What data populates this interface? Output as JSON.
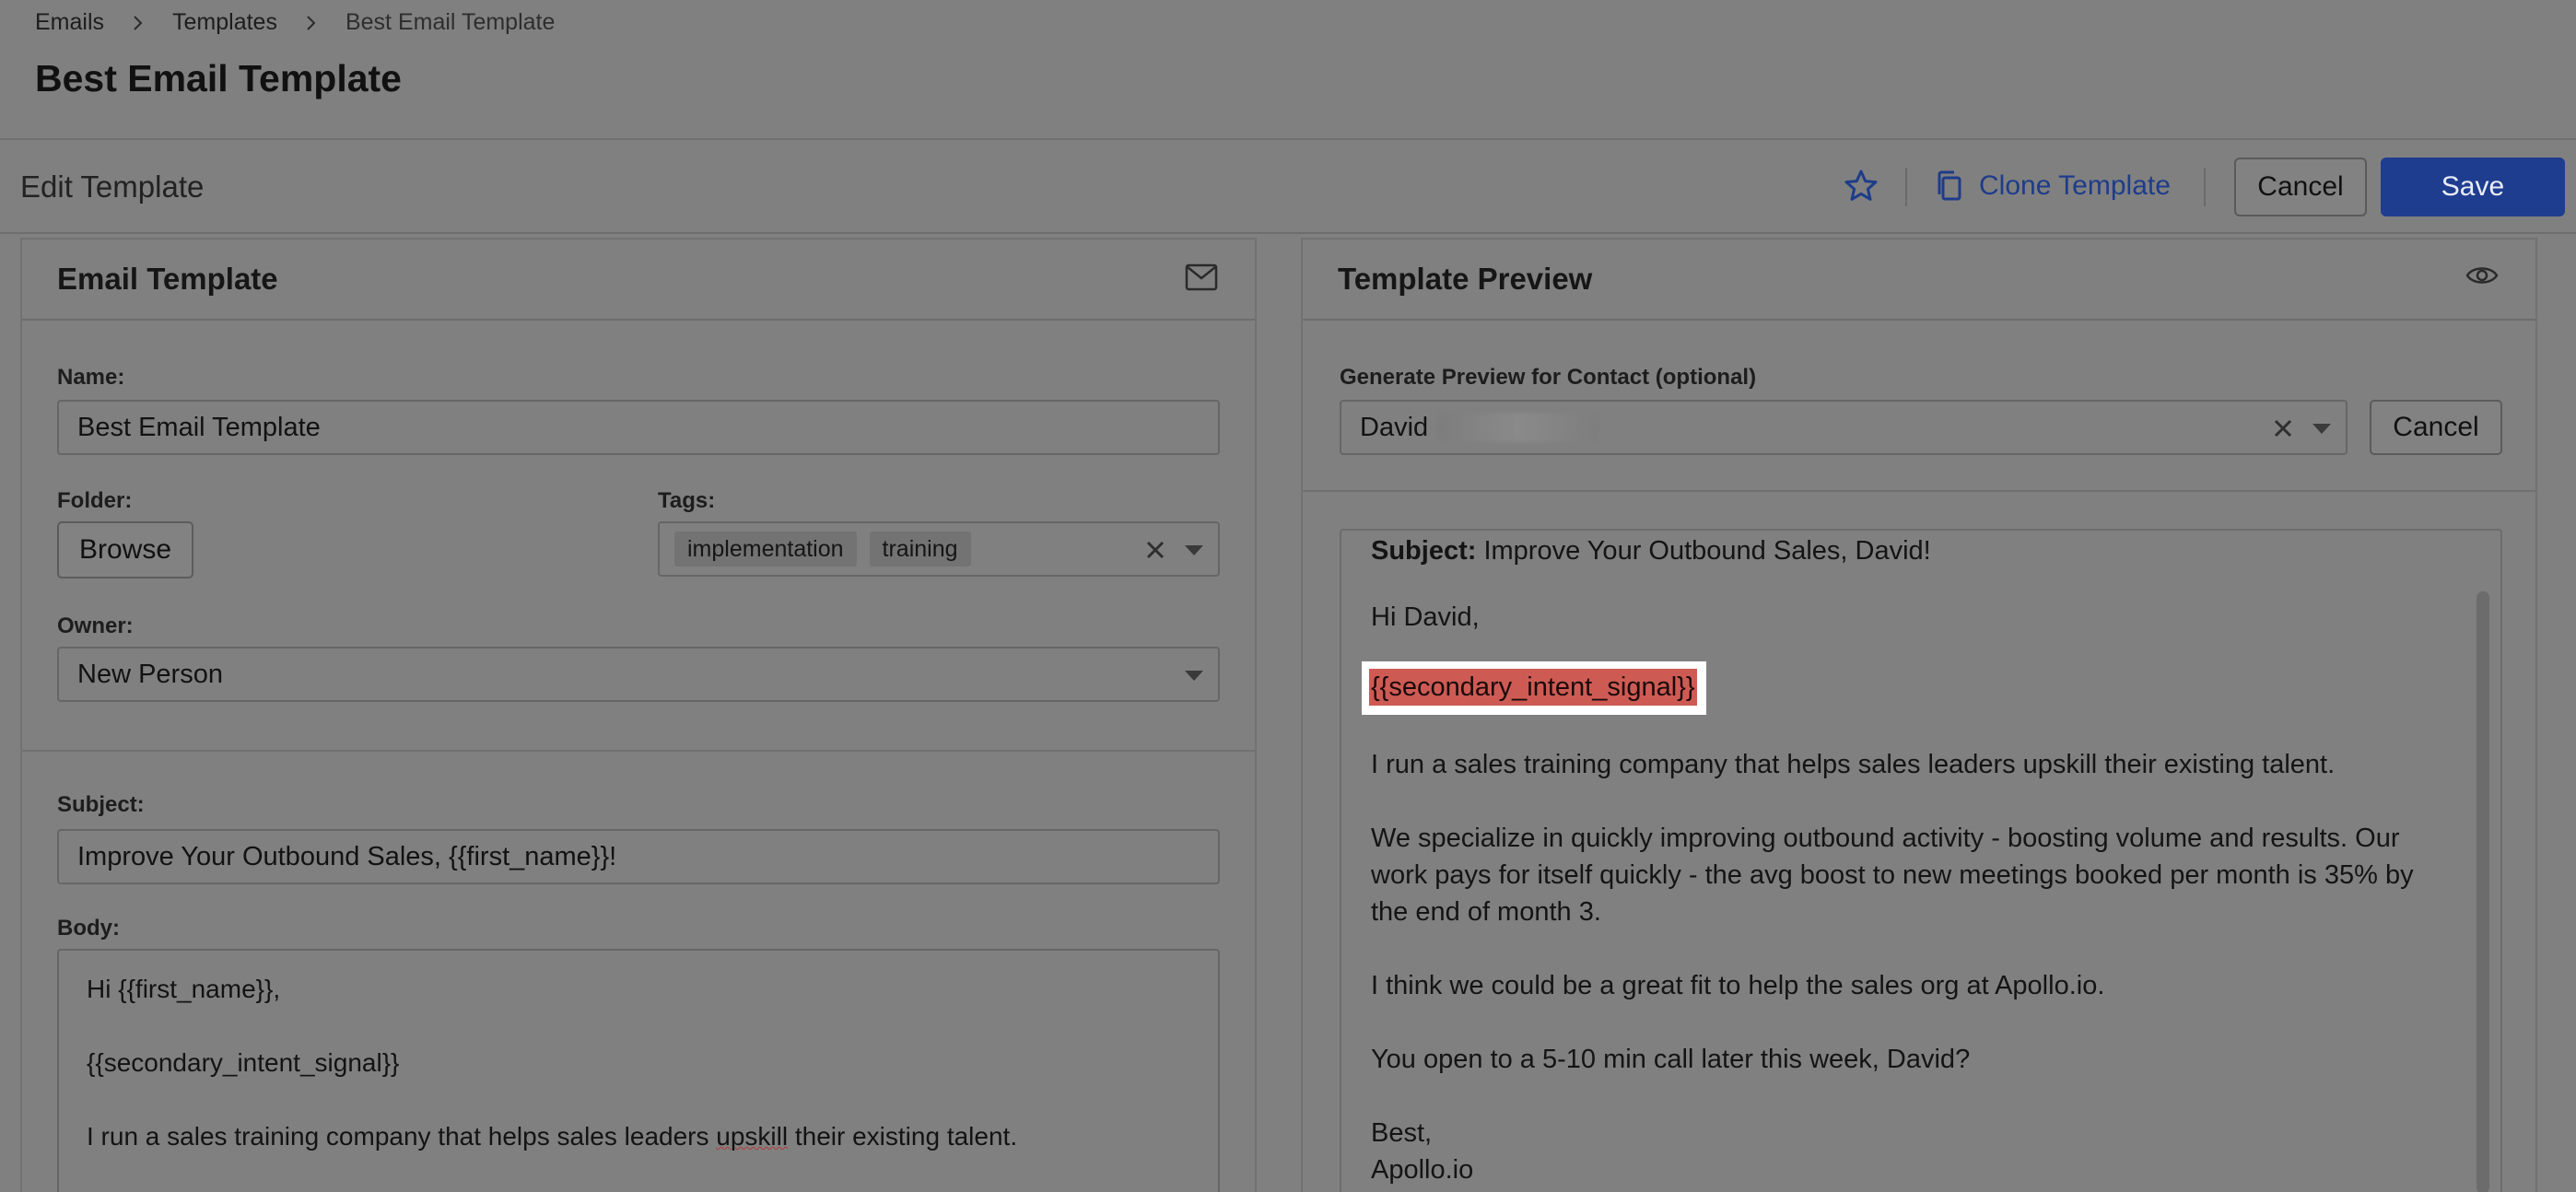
{
  "breadcrumb": {
    "items": [
      "Emails",
      "Templates",
      "Best Email Template"
    ]
  },
  "page": {
    "title": "Best Email Template"
  },
  "editbar": {
    "title": "Edit Template",
    "clone_label": "Clone Template",
    "cancel_label": "Cancel",
    "save_label": "Save"
  },
  "email_template": {
    "title": "Email Template",
    "name_label": "Name:",
    "name_value": "Best Email Template",
    "folder_label": "Folder:",
    "browse_label": "Browse",
    "tags_label": "Tags:",
    "tags": [
      "implementation",
      "training"
    ],
    "owner_label": "Owner:",
    "owner_value": "New Person",
    "subject_label": "Subject:",
    "subject_value": "Improve Your Outbound Sales, {{first_name}}!",
    "body_label": "Body:",
    "body_lines": [
      "Hi {{first_name}},",
      "{{secondary_intent_signal}}",
      "I run a sales training company that helps sales leaders ",
      "upskill",
      " their existing talent."
    ]
  },
  "preview": {
    "title": "Template Preview",
    "contact_label": "Generate Preview for Contact (optional)",
    "contact_value": "David",
    "cancel_label": "Cancel",
    "subject_prefix": "Subject:",
    "subject_text": " Improve Your Outbound Sales, David!",
    "greeting": "Hi David,",
    "intent_signal": "{{secondary_intent_signal}}",
    "para1": "I run a sales training company that helps sales leaders upskill their existing talent.",
    "para2_line1": "We specialize in quickly improving outbound activity - boosting volume and results. Our",
    "para2_line2": "work pays for itself quickly - the avg boost to new meetings booked per month is 35% by",
    "para2_line3": "the end of month 3.",
    "para3": "I think we could be a great fit to help the sales org at Apollo.io.",
    "para4": "You open to a 5-10 min call later this week, David?",
    "signoff": "Best,",
    "signature": "Apollo.io"
  },
  "colors": {
    "primary": "#1f3d8f",
    "link": "#1e3c8a",
    "highlight": "#cd5b54",
    "overlay_bg": "#808080"
  },
  "icons": {
    "breadcrumb_sep": "chevron-right-icon",
    "favorite": "star-icon",
    "clone": "copy-icon",
    "email": "envelope-icon",
    "preview": "eye-icon",
    "clear": "close-icon",
    "dropdown": "caret-down-icon"
  }
}
